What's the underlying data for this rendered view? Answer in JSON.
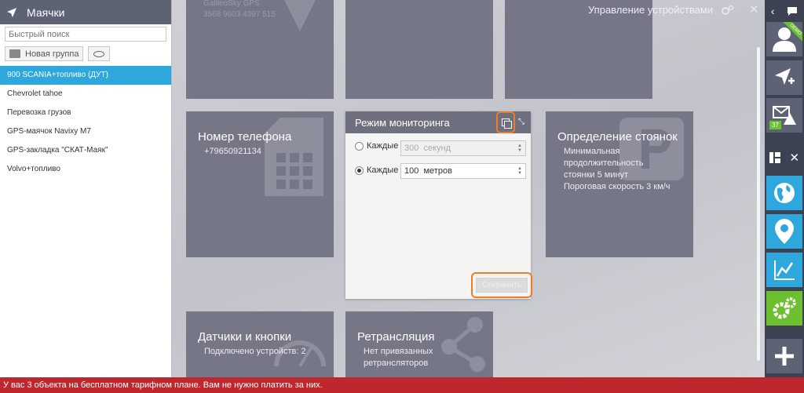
{
  "sidebar": {
    "title": "Маячки",
    "search_placeholder": "Быстрый поиск",
    "new_group_label": "Новая группа",
    "items": [
      {
        "label": "900 SCANIA+топливо (ДУТ)"
      },
      {
        "label": "Chevrolet tahoe"
      },
      {
        "label": "Перевозка грузов"
      },
      {
        "label": "GPS-маячок Navixy M7"
      },
      {
        "label": "GPS-закладка \"СКАТ-Маяк\""
      },
      {
        "label": "Volvo+топливо"
      }
    ]
  },
  "main": {
    "header_title": "Управление устройствами",
    "top_tile": {
      "line1": "GalileoSky GPS",
      "line2": "3568 9603 4397 515"
    },
    "phone_tile": {
      "title": "Номер телефона",
      "value": "+79650921134"
    },
    "parking_tile": {
      "title": "Определение стоянок",
      "lines": [
        "Минимальная",
        "продолжительность",
        "стоянки 5 минут",
        "Пороговая скорость 3 км/ч"
      ]
    },
    "sensors_tile": {
      "title": "Датчики и кнопки",
      "value": "Подключено устройств: 2"
    },
    "relay_tile": {
      "title": "Ретрансляция",
      "lines": [
        "Нет привязанных",
        "ретрансляторов"
      ]
    },
    "monitoring": {
      "title": "Режим мониторинга",
      "every_label_1": "Каждые",
      "time_value": "300",
      "time_unit": "секунд",
      "every_label_2": "Каждые",
      "distance_value": "100",
      "distance_unit": "метров",
      "save_label": "Сохранить"
    }
  },
  "rail": {
    "demo_label": "DEMO",
    "alert_count": "37"
  },
  "statusbar": {
    "message": "У вас 3 объекта на бесплатном тарифном плане. Вам не нужно платить за них."
  },
  "colors": {
    "accent": "#2ea7dc",
    "highlight": "#ef7d23",
    "status_bar": "#c0272d",
    "tile": "#757686",
    "green": "#6cc02f"
  }
}
